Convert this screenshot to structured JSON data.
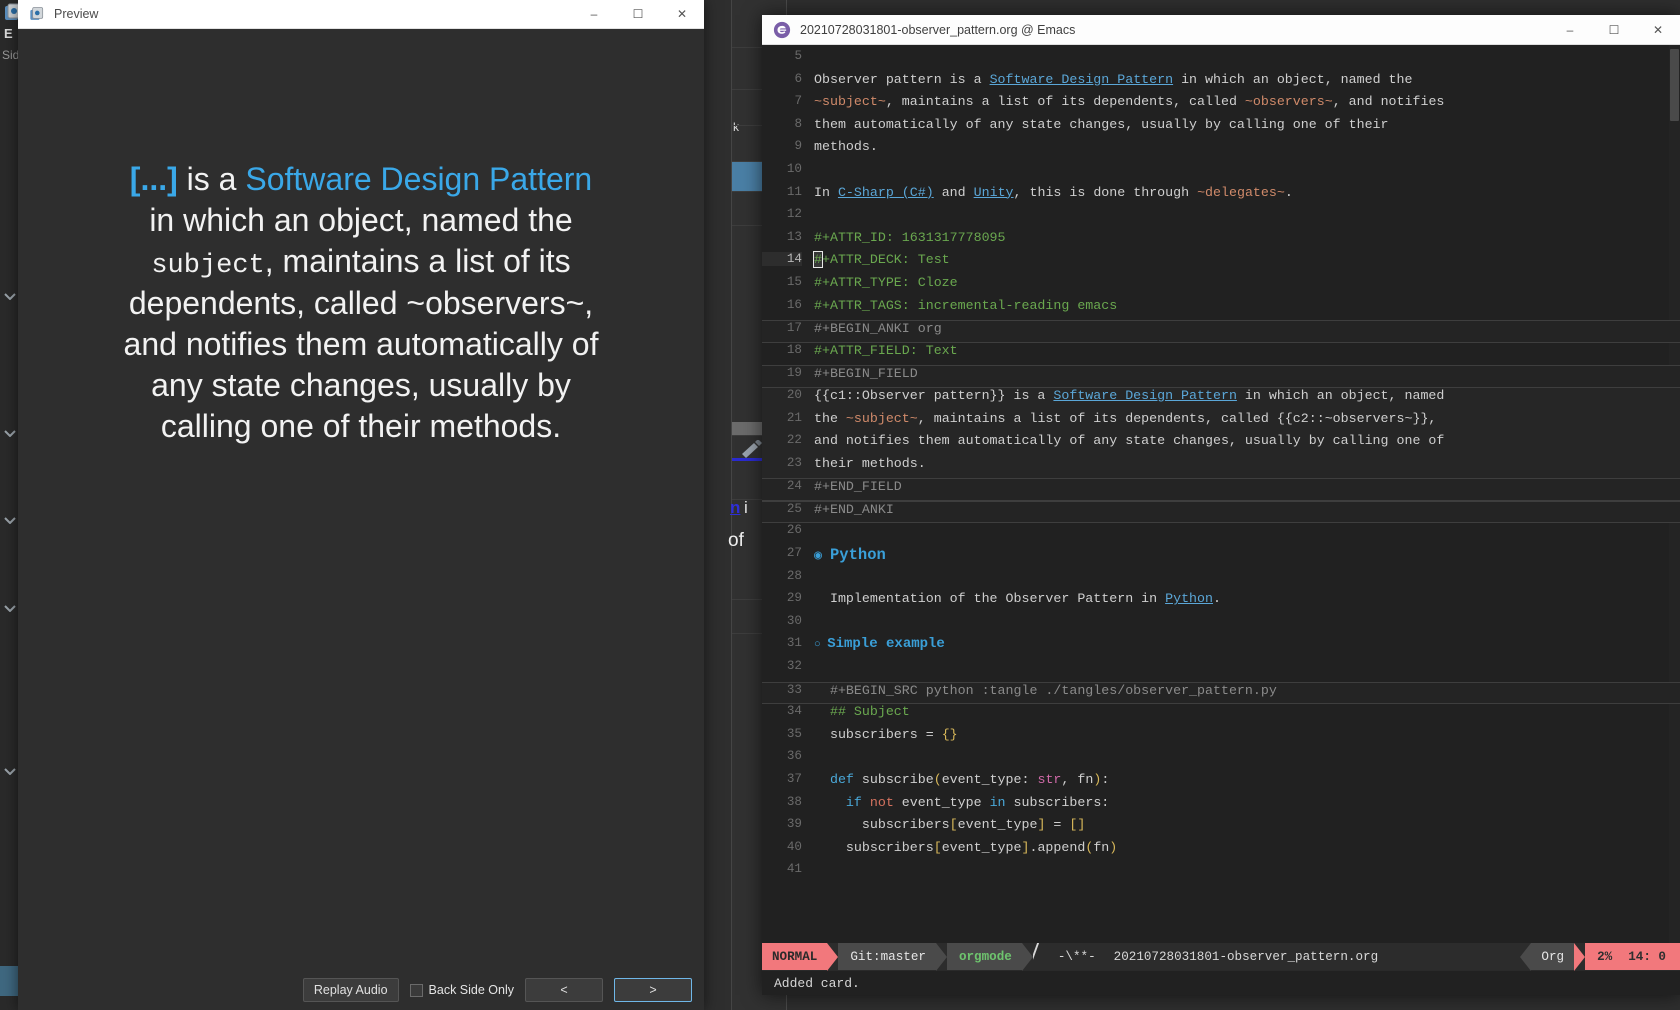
{
  "desktop": {
    "left_strip": {
      "app_label": "E",
      "side_label": "Sid"
    }
  },
  "anki_background": {
    "fragment_k": "k",
    "fragment_n": "n",
    "fragment_i": "i",
    "fragment_of": "of",
    "edit_icon": "pencil-icon"
  },
  "preview_window": {
    "icon": "anki-icon",
    "title": "Preview",
    "minimize": "–",
    "maximize": "☐",
    "close": "✕",
    "card": {
      "cloze_placeholder": "[...]",
      "seg_is_a": " is a ",
      "link_text": "Software Design Pattern",
      "line2": "in which an object, named the",
      "mono_word": "subject",
      "after_mono": ", maintains a list of its",
      "line4": "dependents, called ~observers~,",
      "line5": "and notifies them automatically of",
      "line6": "any state changes, usually by",
      "line7": "calling one of their methods."
    },
    "footer": {
      "replay_audio": "Replay Audio",
      "back_side_only": "Back Side Only",
      "prev": "<",
      "next": ">"
    }
  },
  "emacs_window": {
    "icon": "emacs-icon",
    "title": "20210728031801-observer_pattern.org @ Emacs",
    "minimize": "–",
    "maximize": "☐",
    "close": "✕",
    "lines": [
      {
        "n": "5",
        "kind": "blank"
      },
      {
        "n": "6",
        "kind": "text",
        "parts": [
          {
            "t": "Observer pattern is a "
          },
          {
            "t": "Software Design Pattern",
            "c": "link"
          },
          {
            "t": " in which an object, named the"
          }
        ]
      },
      {
        "n": "7",
        "kind": "text",
        "parts": [
          {
            "t": "~subject~",
            "c": "verb"
          },
          {
            "t": ", maintains a list of its dependents, called "
          },
          {
            "t": "~observers~",
            "c": "verb"
          },
          {
            "t": ", and notifies"
          }
        ]
      },
      {
        "n": "8",
        "kind": "text",
        "parts": [
          {
            "t": "them automatically of any state changes, usually by calling one of their"
          }
        ]
      },
      {
        "n": "9",
        "kind": "text",
        "parts": [
          {
            "t": "methods."
          }
        ]
      },
      {
        "n": "10",
        "kind": "blank"
      },
      {
        "n": "11",
        "kind": "text",
        "parts": [
          {
            "t": "In "
          },
          {
            "t": "C-Sharp (C#)",
            "c": "link"
          },
          {
            "t": " and "
          },
          {
            "t": "Unity",
            "c": "link"
          },
          {
            "t": ", this is done through "
          },
          {
            "t": "~delegates~",
            "c": "verb"
          },
          {
            "t": "."
          }
        ]
      },
      {
        "n": "12",
        "kind": "blank"
      },
      {
        "n": "13",
        "kind": "text",
        "parts": [
          {
            "t": "#+ATTR_ID: 1631317778095",
            "c": "attr"
          }
        ]
      },
      {
        "n": "14",
        "kind": "cursor",
        "cursor_char": "#",
        "parts": [
          {
            "t": "+ATTR_DECK: Test",
            "c": "attr"
          }
        ]
      },
      {
        "n": "15",
        "kind": "text",
        "parts": [
          {
            "t": "#+ATTR_TYPE: Cloze",
            "c": "attr"
          }
        ]
      },
      {
        "n": "16",
        "kind": "text",
        "parts": [
          {
            "t": "#+ATTR_TAGS: incremental-reading emacs",
            "c": "attr"
          }
        ]
      },
      {
        "n": "17",
        "kind": "block",
        "parts": [
          {
            "t": "#+BEGIN_ANKI org"
          }
        ]
      },
      {
        "n": "18",
        "kind": "text",
        "parts": [
          {
            "t": "#+ATTR_FIELD: Text",
            "c": "attr"
          }
        ]
      },
      {
        "n": "19",
        "kind": "block",
        "parts": [
          {
            "t": "#+BEGIN_FIELD"
          }
        ]
      },
      {
        "n": "20",
        "kind": "field",
        "parts": [
          {
            "t": "{{c1::Observer pattern}} is a "
          },
          {
            "t": "Software Design Pattern",
            "c": "link"
          },
          {
            "t": " in which an object, named"
          }
        ]
      },
      {
        "n": "21",
        "kind": "field",
        "parts": [
          {
            "t": "the "
          },
          {
            "t": "~subject~",
            "c": "verb"
          },
          {
            "t": ", maintains a list of its dependents, called {{c2::~observers~}},"
          }
        ]
      },
      {
        "n": "22",
        "kind": "field",
        "parts": [
          {
            "t": "and notifies them automatically of any state changes, usually by calling one of"
          }
        ]
      },
      {
        "n": "23",
        "kind": "field",
        "parts": [
          {
            "t": "their methods."
          }
        ]
      },
      {
        "n": "24",
        "kind": "block",
        "parts": [
          {
            "t": "#+END_FIELD"
          }
        ]
      },
      {
        "n": "25",
        "kind": "block",
        "parts": [
          {
            "t": "#+END_ANKI"
          }
        ]
      },
      {
        "n": "26",
        "kind": "blank"
      },
      {
        "n": "27",
        "kind": "heading1",
        "bullet": "◉",
        "parts": [
          {
            "t": "Python"
          }
        ]
      },
      {
        "n": "28",
        "kind": "blank"
      },
      {
        "n": "29",
        "kind": "text",
        "indent": 1,
        "parts": [
          {
            "t": "Implementation of the Observer Pattern in "
          },
          {
            "t": "Python",
            "c": "link"
          },
          {
            "t": "."
          }
        ]
      },
      {
        "n": "30",
        "kind": "blank"
      },
      {
        "n": "31",
        "kind": "heading2",
        "bullet": "○",
        "parts": [
          {
            "t": "Simple example"
          }
        ]
      },
      {
        "n": "32",
        "kind": "blank"
      },
      {
        "n": "33",
        "kind": "block",
        "indent": 2,
        "parts": [
          {
            "t": "#+BEGIN_SRC python :tangle ./tangles/observer_pattern.py"
          }
        ]
      },
      {
        "n": "34",
        "kind": "src",
        "indent": 2,
        "parts": [
          {
            "t": "## Subject",
            "c": "cmt"
          }
        ]
      },
      {
        "n": "35",
        "kind": "src",
        "indent": 2,
        "parts": [
          {
            "t": "subscribers = "
          },
          {
            "t": "{}",
            "c": "brk"
          }
        ]
      },
      {
        "n": "36",
        "kind": "blank"
      },
      {
        "n": "37",
        "kind": "src",
        "indent": 2,
        "parts": [
          {
            "t": "def ",
            "c": "kw"
          },
          {
            "t": "subscribe"
          },
          {
            "t": "(",
            "c": "brk"
          },
          {
            "t": "event_type: "
          },
          {
            "t": "str",
            "c": "typ"
          },
          {
            "t": ", fn"
          },
          {
            "t": ")",
            "c": "brk"
          },
          {
            "t": ":"
          }
        ]
      },
      {
        "n": "38",
        "kind": "src",
        "indent": 3,
        "parts": [
          {
            "t": "if ",
            "c": "kw"
          },
          {
            "t": "not ",
            "c": "kw2"
          },
          {
            "t": "event_type "
          },
          {
            "t": "in ",
            "c": "kw"
          },
          {
            "t": "subscribers:"
          }
        ]
      },
      {
        "n": "39",
        "kind": "src",
        "indent": 4,
        "parts": [
          {
            "t": "subscribers"
          },
          {
            "t": "[",
            "c": "brk"
          },
          {
            "t": "event_type"
          },
          {
            "t": "]",
            "c": "brk"
          },
          {
            "t": " = "
          },
          {
            "t": "[]",
            "c": "brk"
          }
        ]
      },
      {
        "n": "40",
        "kind": "src",
        "indent": 3,
        "parts": [
          {
            "t": "subscribers"
          },
          {
            "t": "[",
            "c": "brk"
          },
          {
            "t": "event_type"
          },
          {
            "t": "]",
            "c": "brk"
          },
          {
            "t": ".append"
          },
          {
            "t": "(",
            "c": "brk"
          },
          {
            "t": "fn"
          },
          {
            "t": ")",
            "c": "brk"
          }
        ]
      },
      {
        "n": "41",
        "kind": "blank"
      }
    ],
    "modeline": {
      "mode_state": "NORMAL",
      "git": "Git:master",
      "major_mode": "orgmode",
      "flags": "-\\**-",
      "buffer": "20210728031801-observer_pattern.org",
      "right_mode": "Org",
      "percent": "2%",
      "position": "14:  0"
    },
    "echo_area": "Added card."
  },
  "colors": {
    "accent_blue": "#3aa8e8",
    "org_link": "#5ba7d8",
    "verbatim": "#d08a6a",
    "attr_green": "#6aa84f",
    "modeline_red": "#f2787c",
    "modeline_gray": "#4a4a4a",
    "heading_blue": "#3a9fd8"
  }
}
